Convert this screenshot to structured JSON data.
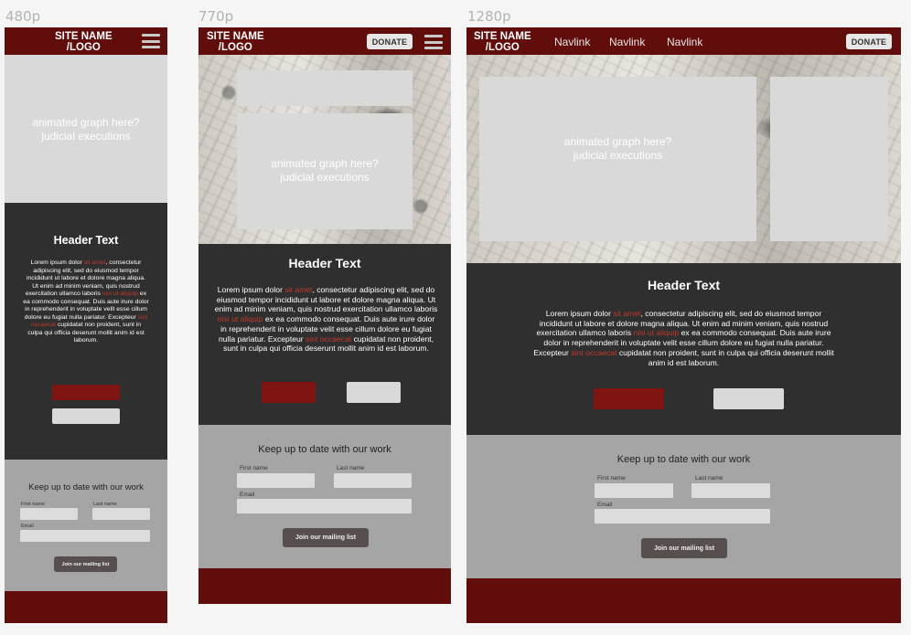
{
  "labels": {
    "small": "480p",
    "medium": "770p",
    "large": "1280p"
  },
  "site": {
    "logo_line1": "SITE NAME",
    "logo_line2": "/LOGO"
  },
  "nav": {
    "links": [
      "Navlink",
      "Navlink",
      "Navlink"
    ],
    "donate": "DONATE"
  },
  "hero": {
    "graph_line1": "animated graph here?",
    "graph_line2": "judicial executions"
  },
  "content": {
    "header": "Header Text",
    "p1": "Lorem ipsum dolor ",
    "r1": "sit amet",
    "p2": ", consectetur adipiscing elit, sed do eiusmod tempor incididunt ut labore et dolore magna aliqua. Ut enim ad minim veniam, quis nostrud exercitation ullamco laboris ",
    "r2": "nisi ut aliquip",
    "p3": " ex ea commodo consequat. Duis aute irure dolor in reprehenderit in voluptate velit esse cillum dolore eu fugiat nulla pariatur. Excepteur ",
    "r3": "sint occaecat",
    "p4": " cupidatat non proident, sunt in culpa qui officia deserunt mollit anim id est laborum."
  },
  "mailing": {
    "title": "Keep up to date with our work",
    "first_name": "First name",
    "last_name": "Last name",
    "email": "Email",
    "button": "Join our mailing list"
  },
  "colors": {
    "brand": "#610d0b",
    "accent_red": "#7e1512",
    "dark": "#2f2f2f",
    "mail_bg": "#a5a5a5"
  }
}
